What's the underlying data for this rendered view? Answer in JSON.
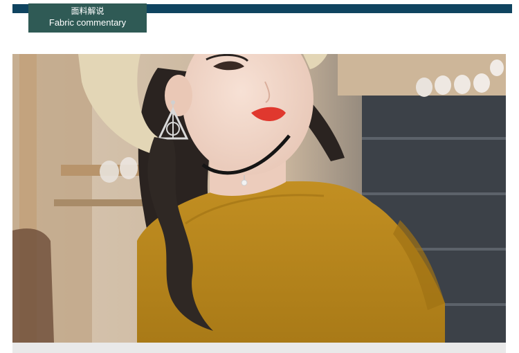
{
  "header": {
    "title_zh": "面料解说",
    "title_en": "Fabric commentary"
  },
  "colors": {
    "accent_bar": "#0f4460",
    "label_bg": "#2f5a55",
    "shirt": "#b7861e"
  }
}
